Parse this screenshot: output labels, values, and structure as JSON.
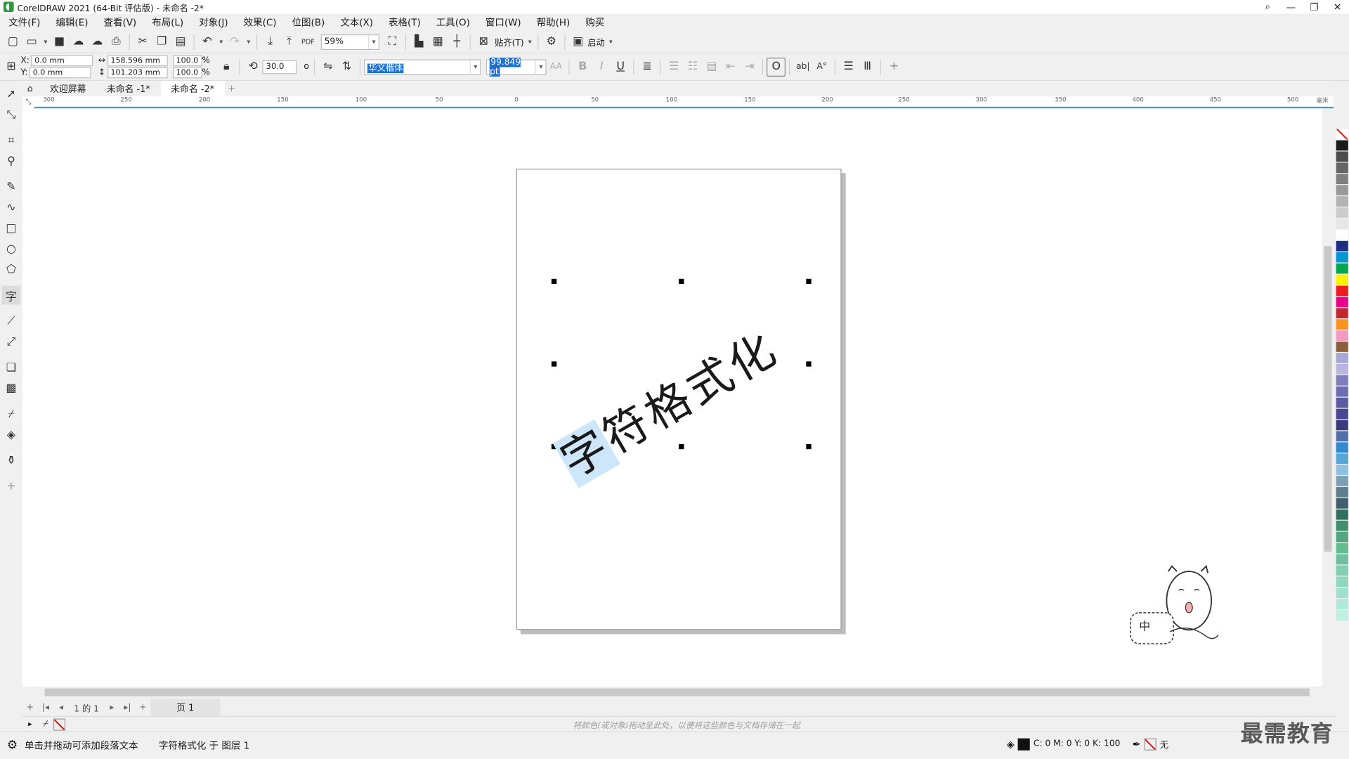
{
  "window": {
    "title": "CorelDRAW 2021 (64-Bit 评估版) - 未命名 -2*",
    "min": "—",
    "max": "❐",
    "close": "✕"
  },
  "menu": [
    "文件(F)",
    "编辑(E)",
    "查看(V)",
    "布局(L)",
    "对象(J)",
    "效果(C)",
    "位图(B)",
    "文本(X)",
    "表格(T)",
    "工具(O)",
    "窗口(W)",
    "帮助(H)",
    "购买"
  ],
  "toolbar1": {
    "zoom": "59%",
    "snap_label": "贴齐(T)",
    "launch_label": "启动"
  },
  "toolbar2": {
    "x_label": "X:",
    "y_label": "Y:",
    "x_value": "0.0 mm",
    "y_value": "0.0 mm",
    "width_value": "158.596 mm",
    "height_value": "101.203 mm",
    "scale_w": "100.0",
    "scale_h": "100.0",
    "percent": "%",
    "rotation": "30.0",
    "degree": "o",
    "font_name": "华文楷体",
    "font_size": "99.849 pt",
    "bold": "B",
    "italic": "I",
    "underline": "U"
  },
  "doc_tabs": [
    "欢迎屏幕",
    "未命名 -1*",
    "未命名 -2*"
  ],
  "hruler_ticks": [
    "300",
    "250",
    "200",
    "150",
    "100",
    "50",
    "0",
    "50",
    "100",
    "150",
    "200",
    "250",
    "300",
    "350",
    "400",
    "450",
    "500"
  ],
  "hruler_unit": "毫米",
  "canvas": {
    "text_highlight": "字",
    "text_rest": "符格式化"
  },
  "mascot_label": "中",
  "pagenav": {
    "page_info": "1 的 1",
    "page_tab": "页 1"
  },
  "colordock_hint": "将颜色(或对象)拖动至此处，以便将这些颜色与文档存储在一起",
  "status": {
    "left": "单击并拖动可添加段落文本",
    "middle": "字符格式化 于 图层 1",
    "cmyk": "C: 0 M: 0 Y: 0 K: 100",
    "outline": "无"
  },
  "watermark": "最需教育",
  "palette_colors": [
    "#1a1a1a",
    "#4d4d4d",
    "#666666",
    "#808080",
    "#999999",
    "#b3b3b3",
    "#cccccc",
    "#e6e6e6",
    "#ffffff",
    "#1b2f8a",
    "#0096d6",
    "#00a651",
    "#fff200",
    "#ed1c24",
    "#ec008c",
    "#c1272d",
    "#f7941d",
    "#f49ac1",
    "#8b5e3c",
    "#a8a8d8",
    "#b9b5e0",
    "#7f7fbf",
    "#6d6db3",
    "#5a5aa6",
    "#474796",
    "#3a3a7c",
    "#4f6fa8",
    "#2e8bd1",
    "#56a7d9",
    "#8fc1e3",
    "#7d9fb3",
    "#5e7f8f",
    "#3f5f6f",
    "#2f6f5f",
    "#3f8f6f",
    "#4fa67f",
    "#5fbf8f",
    "#6fbfa0",
    "#7fcfb0",
    "#8fd9bf",
    "#9fe0cf",
    "#afe9d9",
    "#bfefe0"
  ]
}
